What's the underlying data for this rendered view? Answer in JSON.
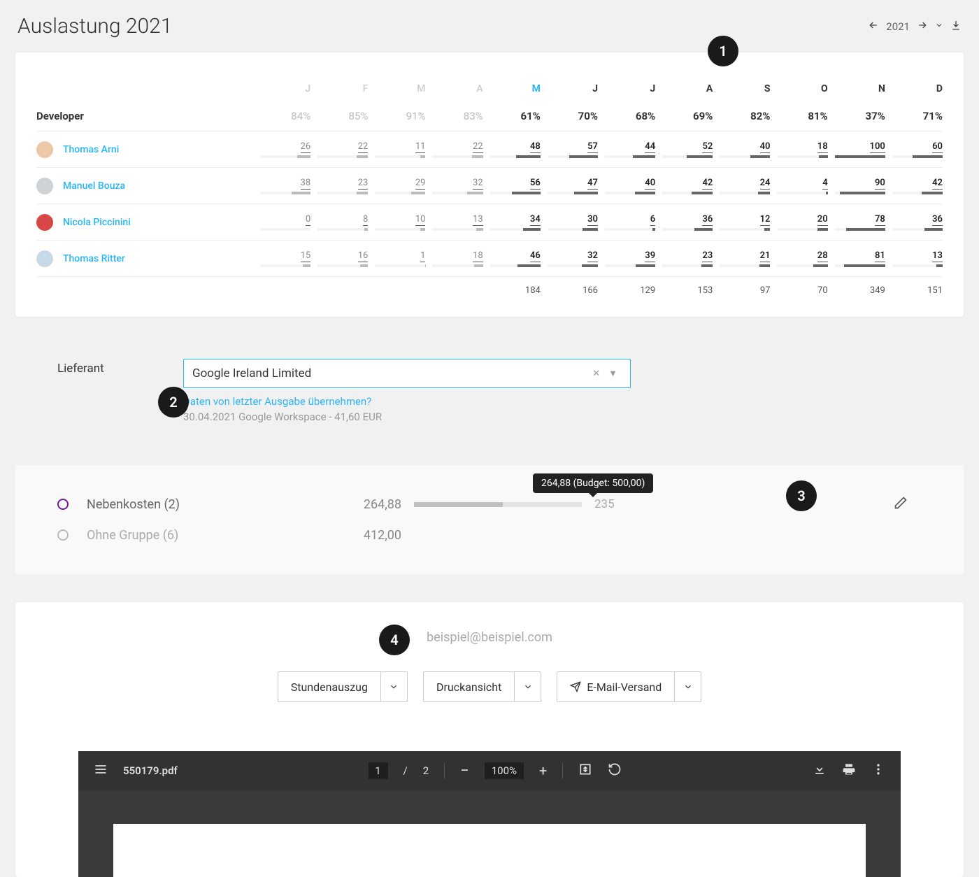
{
  "header": {
    "title": "Auslastung 2021",
    "year": "2021"
  },
  "annotations": [
    "1",
    "2",
    "3",
    "4"
  ],
  "utilization": {
    "role_label": "Developer",
    "months": [
      "J",
      "F",
      "M",
      "A",
      "M",
      "J",
      "J",
      "A",
      "S",
      "O",
      "N",
      "D"
    ],
    "active_month_index": 4,
    "bold_from_index": 4,
    "percentages": [
      "84%",
      "85%",
      "91%",
      "83%",
      "61%",
      "70%",
      "68%",
      "69%",
      "82%",
      "81%",
      "37%",
      "71%"
    ],
    "rows": [
      {
        "name": "Thomas Arni",
        "avatar": "#eac8a8",
        "values": [
          26,
          22,
          11,
          22,
          48,
          57,
          44,
          52,
          40,
          18,
          100,
          60
        ]
      },
      {
        "name": "Manuel Bouza",
        "avatar": "#cfd3d6",
        "values": [
          38,
          23,
          29,
          32,
          56,
          47,
          40,
          42,
          24,
          4,
          90,
          42
        ]
      },
      {
        "name": "Nicola Piccinini",
        "avatar": "#d84747",
        "values": [
          0,
          8,
          10,
          13,
          34,
          30,
          6,
          36,
          12,
          20,
          78,
          36
        ]
      },
      {
        "name": "Thomas Ritter",
        "avatar": "#c9d8e6",
        "values": [
          15,
          16,
          1,
          18,
          46,
          32,
          39,
          23,
          21,
          28,
          81,
          13
        ]
      }
    ],
    "sums": [
      "",
      "",
      "",
      "",
      "184",
      "166",
      "129",
      "153",
      "97",
      "70",
      "349",
      "151"
    ]
  },
  "supplier": {
    "label": "Lieferant",
    "value": "Google Ireland Limited",
    "link_text": "Daten von letzter Ausgabe übernehmen?",
    "meta_text": "30.04.2021 Google Workspace - 41,60 EUR"
  },
  "groups": {
    "tooltip": "264,88 (Budget: 500,00)",
    "rows": [
      {
        "label": "Nebenkosten (2)",
        "amount": "264,88",
        "remaining": "235",
        "progress_pct": 53,
        "muted": false
      },
      {
        "label": "Ohne Gruppe (6)",
        "amount": "412,00",
        "remaining": "",
        "progress_pct": null,
        "muted": true
      }
    ]
  },
  "email_section": {
    "email": "beispiel@beispiel.com",
    "buttons": [
      {
        "label": "Stundenauszug"
      },
      {
        "label": "Druckansicht"
      },
      {
        "label": "E-Mail-Versand",
        "has_icon": true
      }
    ]
  },
  "pdf": {
    "filename": "550179.pdf",
    "current_page": "1",
    "page_sep": "/",
    "total_pages": "2",
    "zoom": "100%"
  }
}
